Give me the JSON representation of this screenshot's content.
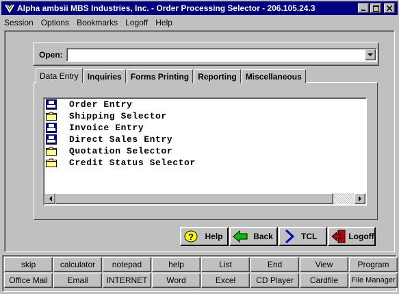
{
  "window": {
    "title": "Alpha ambsii MBS Industries, Inc. - Order Processing Selector - 206.105.24.3",
    "icon": "alpha-app-icon"
  },
  "menubar": [
    {
      "label": "Session"
    },
    {
      "label": "Options"
    },
    {
      "label": "Bookmarks"
    },
    {
      "label": "Logoff"
    },
    {
      "label": "Help"
    }
  ],
  "open": {
    "label": "Open:",
    "value": ""
  },
  "tabs": [
    {
      "label": "Data Entry",
      "active": true
    },
    {
      "label": "Inquiries"
    },
    {
      "label": "Forms Printing"
    },
    {
      "label": "Reporting"
    },
    {
      "label": "Miscellaneous"
    }
  ],
  "list": {
    "items": [
      {
        "label": "Order Entry",
        "icon": "printer-doc-icon"
      },
      {
        "label": "Shipping Selector",
        "icon": "folder-icon"
      },
      {
        "label": "Invoice Entry",
        "icon": "printer-doc-icon"
      },
      {
        "label": "Direct Sales Entry",
        "icon": "printer-doc-icon"
      },
      {
        "label": "Quotation Selector",
        "icon": "folder-icon"
      },
      {
        "label": "Credit Status Selector",
        "icon": "folder-icon"
      }
    ]
  },
  "actions": {
    "help": "Help",
    "back": "Back",
    "tcl": "TCL",
    "logoff": "Logoff"
  },
  "toolbar": {
    "row1": [
      "skip",
      "calculator",
      "notepad",
      "help",
      "List",
      "End",
      "View",
      "Program"
    ],
    "row2": [
      "Office Mail",
      "Email",
      "INTERNET",
      "Word",
      "Excel",
      "CD Player",
      "Cardfile",
      "File Manager"
    ]
  }
}
